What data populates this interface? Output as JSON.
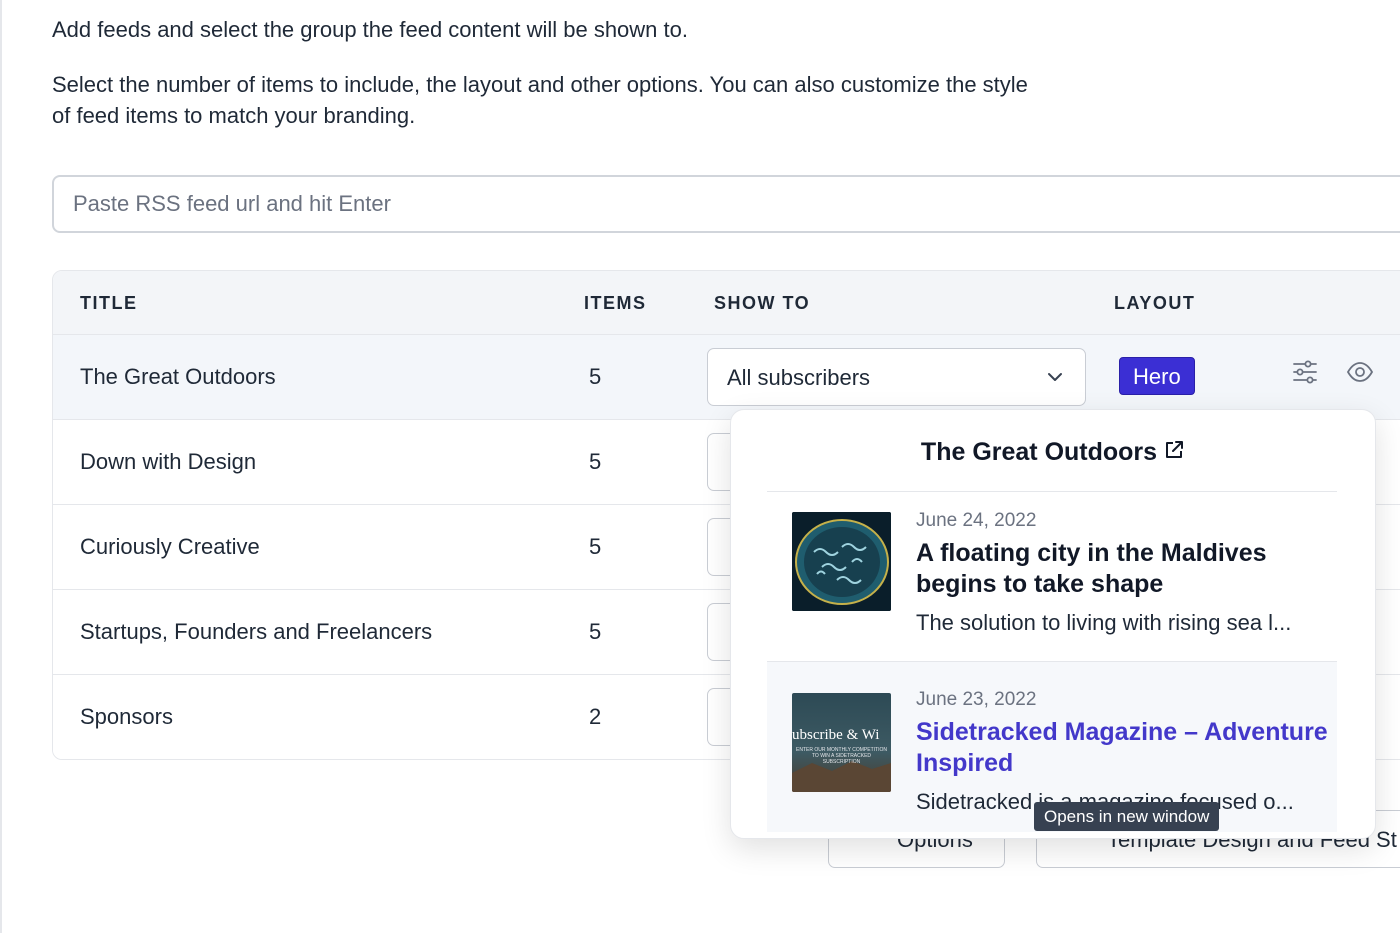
{
  "intro": {
    "line1": "Add feeds and select the group the feed content will be shown to.",
    "line2": "Select the number of items to include, the layout and other options. You can also customize the style of feed items to match your branding."
  },
  "rss_input": {
    "placeholder": "Paste RSS feed url and hit Enter",
    "value": ""
  },
  "table": {
    "headers": {
      "title": "TITLE",
      "items": "ITEMS",
      "show_to": "SHOW TO",
      "layout": "LAYOUT"
    },
    "rows": [
      {
        "title": "The Great Outdoors",
        "items": "5",
        "show_to": "All subscribers",
        "layout": "Hero"
      },
      {
        "title": "Down with Design",
        "items": "5"
      },
      {
        "title": "Curiously Creative",
        "items": "5"
      },
      {
        "title": "Startups, Founders and Freelancers",
        "items": "5"
      },
      {
        "title": "Sponsors",
        "items": "2"
      }
    ]
  },
  "bottom_buttons": {
    "options": "Options",
    "template": "Template Design and Feed St"
  },
  "popover": {
    "title": "The Great Outdoors",
    "articles": [
      {
        "date": "June 24, 2022",
        "title": "A floating city in the Maldives begins to take shape",
        "description": "The solution to living with rising sea l...",
        "thumb_icon": "coral-island-image"
      },
      {
        "date": "June 23, 2022",
        "title": "Sidetracked Magazine – Adventure Inspired",
        "description": "Sidetracked is a magazine focused o...",
        "thumb_icon": "magazine-cover-image",
        "thumb_text": "ubscribe & Wi",
        "thumb_subtext": "ENTER OUR MONTHLY COMPETITION TO WIN A SIDETRACKED SUBSCRIPTION"
      }
    ]
  },
  "tooltip": {
    "text": "Opens in new window"
  },
  "colors": {
    "accent": "#3b2fd4",
    "link": "#4338ca",
    "header_bg": "#f3f5f8",
    "tooltip_bg": "#374151"
  }
}
